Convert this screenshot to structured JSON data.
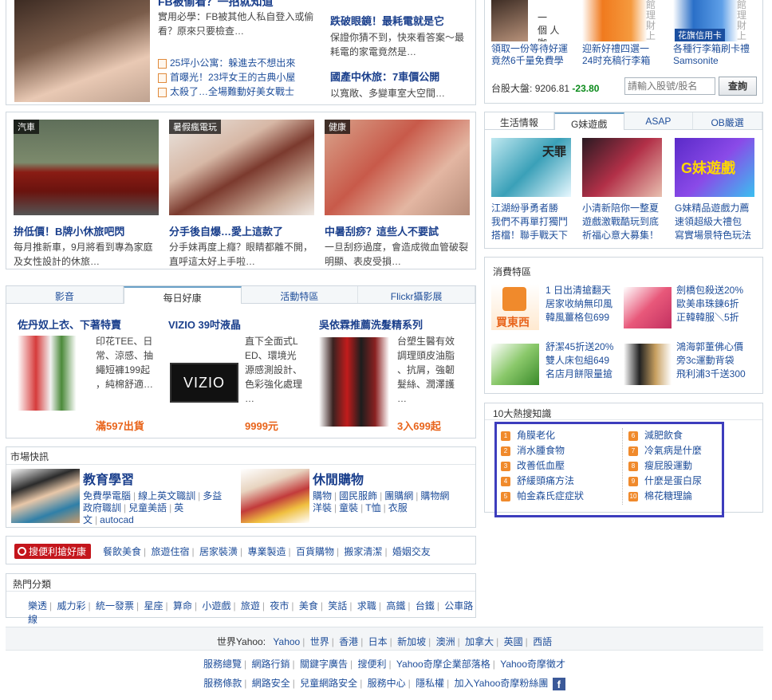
{
  "top_news": {
    "lead_title": "FB被偷看？一招就知道",
    "lead_desc": "實用必學：FB被其他人私自登入或偷看？原來只要檢查…",
    "list": [
      "25坪小公寓：躲進去不想出來",
      "首曝光！23坪女王的古典小屋",
      "太殺了…全場難動好美女戰士"
    ],
    "mid_title": "跌破眼鏡！最耗電就是它",
    "mid_desc": "保證你猜不到，快來看答案～最耗電的家電竟然是…",
    "mid2_title": "國產中休旅：7車價公開",
    "mid2_desc": "以寬敞、多變車室大空間…"
  },
  "top_right": {
    "cafe_text": [
      "一",
      "個",
      "人",
      "咖",
      "啡"
    ],
    "items": [
      {
        "line1": "領取一份等待好運",
        "line2": "竟然6千量免費學"
      },
      {
        "line1": "迎新好禮四選一",
        "line2": "24时充稿行李箱"
      },
      {
        "line1": "各種行李箱刷卡禮",
        "line2": "Samsonite"
      }
    ],
    "card_label": "花旗信用卡",
    "side_text": [
      "館",
      "理",
      "財",
      "上"
    ],
    "stock_label": "台股大盤:",
    "stock_value": "9206.81",
    "stock_change": "-23.80",
    "stock_placeholder": "請輸入股號/股名",
    "stock_button": "查詢"
  },
  "cards": [
    {
      "tag": "汽車",
      "title": "拚低價！B牌小休旅吧閃",
      "desc": "每月推新車，9月將看到專為家庭及女性設計的休旅…"
    },
    {
      "tag": "暑假瘋電玩",
      "title": "分手後自爆…愛上這款了",
      "desc": "分手妹再度上癮？眼睛都離不開，直呼這太好上手啦…"
    },
    {
      "tag": "健康",
      "title": "中暑刮痧？這些人不要試",
      "desc": "一旦刮痧過度，會造成微血管破裂明顯、表皮受損…"
    }
  ],
  "media_tabs": [
    "影音",
    "每日好康",
    "活動特區",
    "Flickr攝影展"
  ],
  "deals": [
    {
      "title": "佐丹奴上衣、下著特賣",
      "desc": [
        "印花TEE、日",
        "常、涼感、抽",
        "繩短褲199起",
        "，純棉舒適…"
      ],
      "price": "滿597出貨"
    },
    {
      "title": "VIZIO 39吋液晶",
      "logo": "VIZIO",
      "desc": [
        "直下全面式L",
        "ED、環境光",
        "源感測設計、",
        "色彩強化處理",
        "…"
      ],
      "price": "9999元"
    },
    {
      "title": "吳依霖推薦洗髮精系列",
      "desc": [
        "台塑生醫有效",
        "調理頭皮油脂",
        "、抗屑，強韌",
        "髮絲、潤澤護",
        "…"
      ],
      "price": "3入699起"
    }
  ],
  "market": {
    "header": "市場快訊",
    "edu_title": "教育學習",
    "edu_links": [
      "免費學電腦",
      "線上英文職訓",
      "多益",
      "政府職訓",
      "兒童美語",
      "英文",
      "autocad"
    ],
    "shop_title": "休閒購物",
    "shop_links": [
      "購物",
      "國民服飾",
      "團購網",
      "購物網",
      "洋裝",
      "童裝",
      "T恤",
      "衣服"
    ]
  },
  "search_bar": {
    "badge": "搜便利搶好康",
    "links": [
      "餐飲美食",
      "旅遊住宿",
      "居家裝潢",
      "專業製造",
      "百貨購物",
      "搬家清潔",
      "婚姻交友"
    ]
  },
  "popular": {
    "header": "熱門分類",
    "links": [
      "樂透",
      "威力彩",
      "統一發票",
      "星座",
      "算命",
      "小遊戲",
      "旅遊",
      "夜市",
      "美食",
      "笑話",
      "求職",
      "高鐵",
      "台鐵",
      "公車路線"
    ]
  },
  "right_tabs": [
    "生活情報",
    "G妹遊戲",
    "ASAP",
    "OB嚴選"
  ],
  "games": [
    {
      "label": "天罪",
      "line1": "江湖紛爭勇者勝",
      "line2": "我們不再單打獨鬥",
      "line3": "搭檔！聯手戰天下"
    },
    {
      "label": "",
      "line1": "小清新陪你一整夏",
      "line2": "遊戲激戰酷玩到底",
      "line3": "祈福心意大募集！"
    },
    {
      "label": "G妹遊戲",
      "line1": "G妹精品遊戲力薦",
      "line2": "速領超級大禮包",
      "line3": "寫實場景特色玩法"
    }
  ],
  "consumer": {
    "header": "消費特區",
    "buy_label": "買東西",
    "items": [
      {
        "lines": [
          "1 日出清搶翻天",
          "居家收納無印風",
          "韓風薑格包699"
        ]
      },
      {
        "lines": [
          "劍橋包殺送20%",
          "歐美串珠鍊6折",
          "正韓韓服＼5折"
        ]
      },
      {
        "lines": [
          "舒潔45折送20%",
          "雙人床包組649",
          "名店月餅限量搶"
        ]
      },
      {
        "lines": [
          "鴻海郭董佛心價",
          "旁3c運動背袋",
          "飛利浦3千送300"
        ]
      }
    ]
  },
  "hot_search": {
    "header": "10大熱搜知識",
    "left": [
      "角膜老化",
      "消水腫食物",
      "改善低血壓",
      "舒緩頭痛方法",
      "帕金森氏症症狀"
    ],
    "left_nums": [
      "1",
      "2",
      "3",
      "4",
      "5"
    ],
    "right": [
      "減肥飲食",
      "冷氣病是什麼",
      "瘦屁股運動",
      "什麼是蛋白尿",
      "棉花糖理論"
    ],
    "right_nums": [
      "6",
      "7",
      "8",
      "9",
      "10"
    ]
  },
  "footer": {
    "world_label": "世界Yahoo:",
    "world": [
      "Yahoo",
      "世界",
      "香港",
      "日本",
      "新加坡",
      "澳洲",
      "加拿大",
      "英國",
      "西語"
    ],
    "row2": [
      "服務總覽",
      "網路行銷",
      "關鍵字廣告",
      "搜便利",
      "Yahoo奇摩企業部落格",
      "Yahoo奇摩徵才"
    ],
    "row3": [
      "服務條款",
      "網路安全",
      "兒童網路安全",
      "服務中心",
      "隱私權",
      "加入Yahoo奇摩粉絲團"
    ],
    "fb_icon": "f"
  },
  "colors": {
    "accent": "#1f4e9a",
    "price": "#e8641b",
    "highlight_box": "#3d3dbd",
    "stock_down": "#0a8a1a"
  }
}
